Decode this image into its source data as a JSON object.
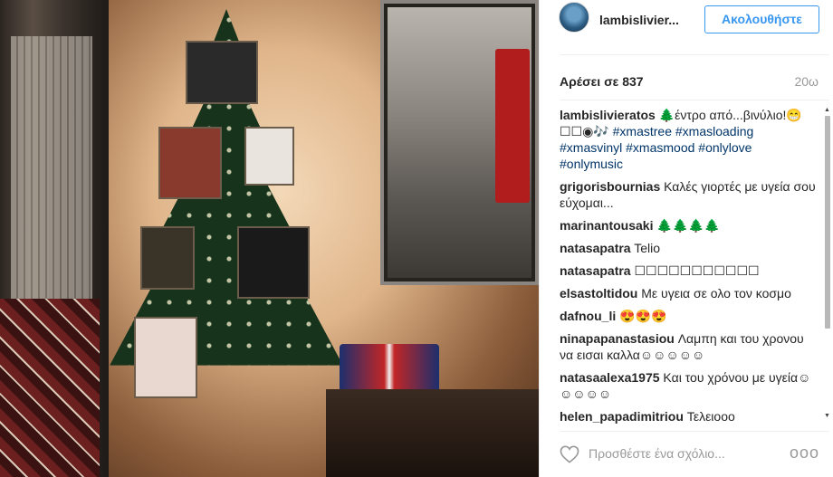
{
  "header": {
    "username": "lambislivier...",
    "follow_label": "Ακολουθήστε"
  },
  "stats": {
    "likes": "Αρέσει σε 837",
    "time": "20ω"
  },
  "comments": [
    {
      "author": "lambislivieratos",
      "parts": [
        {
          "kind": "text",
          "value": " 🌲έντρο από...βινύλιο!😁 ☐☐◉🎶 "
        },
        {
          "kind": "tag",
          "value": "#xmastree"
        },
        {
          "kind": "text",
          "value": " "
        },
        {
          "kind": "tag",
          "value": "#xmasloading"
        },
        {
          "kind": "text",
          "value": " "
        },
        {
          "kind": "tag",
          "value": "#xmasvinyl"
        },
        {
          "kind": "text",
          "value": " "
        },
        {
          "kind": "tag",
          "value": "#xmasmood"
        },
        {
          "kind": "text",
          "value": " "
        },
        {
          "kind": "tag",
          "value": "#onlylove"
        },
        {
          "kind": "text",
          "value": " "
        },
        {
          "kind": "tag",
          "value": "#onlymusic"
        }
      ]
    },
    {
      "author": "grigorisbournias",
      "parts": [
        {
          "kind": "text",
          "value": " Καλές γιορτές με υγεία σου εύχομαι..."
        }
      ]
    },
    {
      "author": "marinantousaki",
      "parts": [
        {
          "kind": "text",
          "value": " 🌲🌲🌲🌲"
        }
      ]
    },
    {
      "author": "natasapatra",
      "parts": [
        {
          "kind": "text",
          "value": " Telio"
        }
      ]
    },
    {
      "author": "natasapatra",
      "parts": [
        {
          "kind": "text",
          "value": " ☐☐☐☐☐☐☐☐☐☐☐"
        }
      ]
    },
    {
      "author": "elsastoltidou",
      "parts": [
        {
          "kind": "text",
          "value": " Με υγεια σε ολο τον κοσμο"
        }
      ]
    },
    {
      "author": "dafnou_li",
      "parts": [
        {
          "kind": "text",
          "value": " 😍😍😍"
        }
      ]
    },
    {
      "author": "ninapapanastasiou",
      "parts": [
        {
          "kind": "text",
          "value": " Λαμπη και του χρονου να εισαι καλλα☺☺☺☺☺"
        }
      ]
    },
    {
      "author": "natasaalexa1975",
      "parts": [
        {
          "kind": "text",
          "value": " Και του χρόνου με υγεία☺☺☺☺☺"
        }
      ]
    },
    {
      "author": "helen_papadimitriou",
      "parts": [
        {
          "kind": "text",
          "value": " Τελειοοο"
        }
      ]
    }
  ],
  "footer": {
    "comment_placeholder": "Προσθέστε ένα σχόλιο...",
    "more_label": "ooo"
  },
  "icons": {
    "heart": "heart-outline-icon",
    "scroll_up": "triangle-up-icon",
    "scroll_down": "triangle-down-icon"
  },
  "colors": {
    "follow_blue": "#3897f0",
    "hashtag": "#003569",
    "muted": "#999999"
  }
}
